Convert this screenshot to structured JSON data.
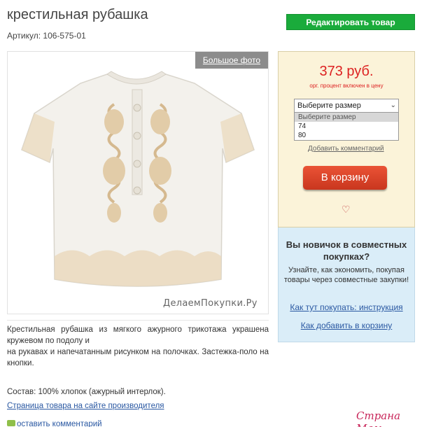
{
  "product": {
    "title": "крестильная рубашка",
    "article": "Артикул: 106-575-01",
    "edit_button": "Редактировать товар",
    "big_photo_label": "Большое фото",
    "watermark": "ДелаемПокупки.Ру"
  },
  "price_box": {
    "price": "373 руб.",
    "price_note": "орг. процент включен в цену",
    "select": {
      "value": "Выберите размер",
      "options": [
        "Выберите размер",
        "74",
        "80"
      ]
    },
    "add_comment": "Добавить комментарий",
    "cart_button": "В корзину",
    "heart_glyph": "♡"
  },
  "newbie_box": {
    "title": "Вы новичок в совместных покупках?",
    "text": "Узнайте, как экономить, покупая товары через совместные закупки!",
    "link_howto": "Как тут покупать: инструкция",
    "link_cart": "Как добавить в корзину"
  },
  "description": {
    "line1": "Крестильная рубашка из мягкого ажурного трикотажа украшена кружевом по подолу и",
    "line2": "на рукавах и напечатанным рисунком на полочках. Застежка-поло на кнопки.",
    "composition": "Состав: 100% хлопок (ажурный интерлок).",
    "maker_link": "Страница товара на сайте производителя",
    "leave_comment": "оставить комментарий"
  },
  "site_logo": "Страна Мам",
  "colors": {
    "edit_green": "#1aab3b",
    "price_red": "#dd2222",
    "cart_red": "#d9432a",
    "link_blue": "#2a58a2",
    "price_box_bg": "#fbf3d9",
    "newbie_box_bg": "#daedf8"
  }
}
